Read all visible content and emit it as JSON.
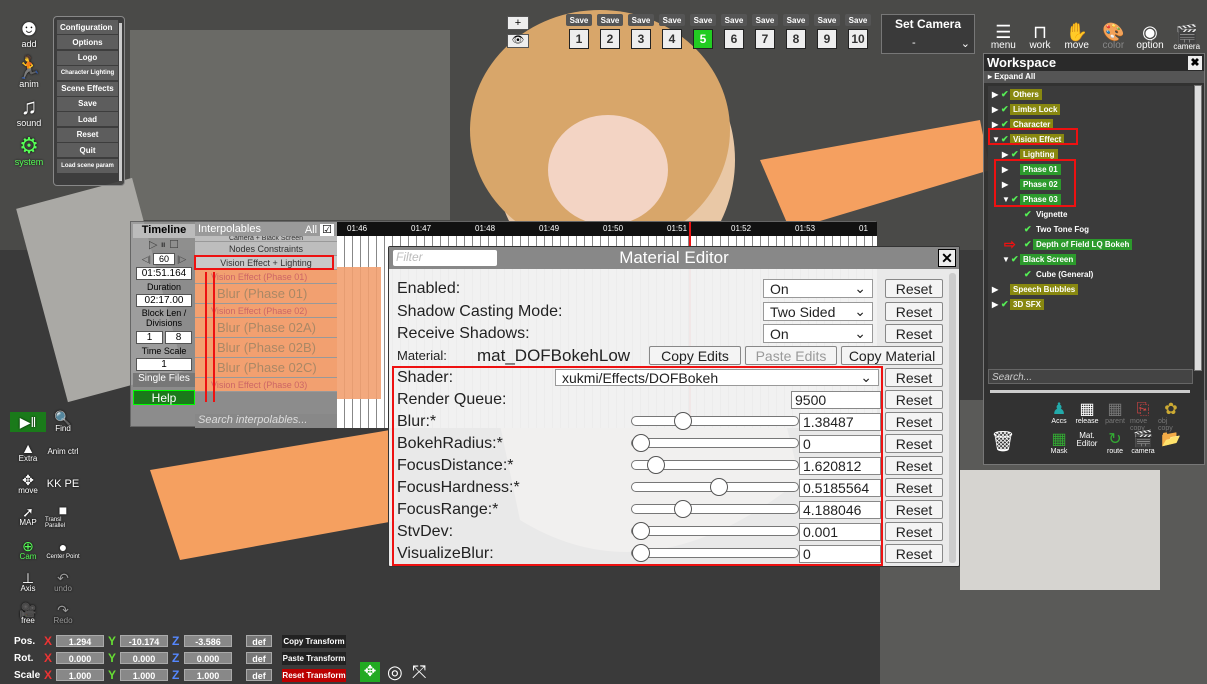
{
  "left_icons": [
    {
      "label": "add",
      "icon": "add-icon"
    },
    {
      "label": "anim",
      "icon": "anim-icon"
    },
    {
      "label": "sound",
      "icon": "sound-icon"
    },
    {
      "label": "system",
      "icon": "system-icon"
    }
  ],
  "config_menu": [
    "Configuration",
    "Options",
    "Logo",
    "Character Lighting",
    "Scene Effects",
    "Save",
    "Load",
    "Reset",
    "Quit",
    "Load scene param"
  ],
  "save_slots": {
    "save_label": "Save",
    "numbers": [
      "1",
      "2",
      "3",
      "4",
      "5",
      "6",
      "7",
      "8",
      "9",
      "10"
    ],
    "active": "5"
  },
  "set_camera": {
    "title": "Set Camera",
    "value": "-"
  },
  "top_icons": [
    "menu",
    "work",
    "move",
    "color",
    "option",
    "camera"
  ],
  "workspace": {
    "title": "Workspace",
    "expand_all": "Expand All",
    "tree": [
      {
        "label": "Others",
        "level": 0
      },
      {
        "label": "Limbs Lock",
        "level": 0
      },
      {
        "label": "Character",
        "level": 0
      },
      {
        "label": "Vision Effect",
        "level": 0
      },
      {
        "label": "Lighting",
        "level": 1
      },
      {
        "label": "Phase 01",
        "level": 1
      },
      {
        "label": "Phase 02",
        "level": 1
      },
      {
        "label": "Phase 03",
        "level": 1
      },
      {
        "label": "Vignette",
        "level": 2
      },
      {
        "label": "Two Tone Fog",
        "level": 2
      },
      {
        "label": "Depth of Field LQ Bokeh",
        "level": 2
      },
      {
        "label": "Black Screen",
        "level": 1
      },
      {
        "label": "Cube (General)",
        "level": 2
      },
      {
        "label": "Speech Bubbles",
        "level": 0
      },
      {
        "label": "3D SFX",
        "level": 0
      }
    ],
    "search_placeholder": "Search...",
    "tools": [
      "Accs",
      "release",
      "parent",
      "move copy",
      "obj copy",
      "Mask",
      "Mat. Editor",
      "route",
      "camera"
    ]
  },
  "timeline": {
    "title": "Timeline",
    "fps": "60",
    "time": "01:51.164",
    "duration_label": "Duration",
    "duration": "02:17.00",
    "block_label": "Block Len / Divisions",
    "block_len": "1",
    "divisions": "8",
    "time_scale_label": "Time Scale",
    "time_scale": "1",
    "single_files": "Single Files",
    "help": "Help",
    "interpolables_label": "Interpolables",
    "all_label": "All",
    "rows": [
      "Camera + Black Screen",
      "Nodes Constraints",
      "Vision Effect + Lighting",
      "Vision Effect (Phase 01)",
      "Blur (Phase 01)",
      "Vision Effect (Phase 02)",
      "Blur (Phase 02A)",
      "Blur (Phase 02B)",
      "Blur (Phase 02C)",
      "Vision Effect (Phase 03)"
    ],
    "search_placeholder": "Search interpolables...",
    "ruler": [
      "01:46",
      "01:47",
      "01:48",
      "01:49",
      "01:50",
      "01:51",
      "01:52",
      "01:53",
      "01"
    ]
  },
  "material_editor": {
    "title": "Material Editor",
    "filter_placeholder": "Filter",
    "enabled_label": "Enabled:",
    "enabled_value": "On",
    "shadow_label": "Shadow Casting Mode:",
    "shadow_value": "Two Sided",
    "receive_label": "Receive Shadows:",
    "receive_value": "On",
    "material_label": "Material:",
    "material_name": "mat_DOFBokehLow",
    "copy_edits": "Copy Edits",
    "paste_edits": "Paste Edits",
    "copy_material": "Copy Material",
    "shader_label": "Shader:",
    "shader_value": "xukmi/Effects/DOFBokeh",
    "render_queue_label": "Render Queue:",
    "render_queue": "9500",
    "reset": "Reset",
    "props": [
      {
        "label": "Blur:*",
        "value": "1.38487",
        "pos": 0.28
      },
      {
        "label": "BokehRadius:*",
        "value": "0",
        "pos": 0.0
      },
      {
        "label": "FocusDistance:*",
        "value": "1.620812",
        "pos": 0.1
      },
      {
        "label": "FocusHardness:*",
        "value": "0.5185564",
        "pos": 0.52
      },
      {
        "label": "FocusRange:*",
        "value": "4.188046",
        "pos": 0.28
      },
      {
        "label": "StvDev:",
        "value": "0.001",
        "pos": 0.0
      },
      {
        "label": "VisualizeBlur:",
        "value": "0",
        "pos": 0.0
      }
    ]
  },
  "side_tools": [
    "Find",
    "Anim ctrl",
    "Extra",
    "KK PE",
    "move",
    "MAP",
    "Transl Parallel",
    "Cam",
    "Center Point",
    "Axis",
    "undo",
    "free",
    "Redo"
  ],
  "transform": {
    "pos_label": "Pos.",
    "rot_label": "Rot.",
    "scale_label": "Scale",
    "pos": [
      "1.294",
      "-10.174",
      "-3.586"
    ],
    "rot": [
      "0.000",
      "0.000",
      "0.000"
    ],
    "scale": [
      "1.000",
      "1.000",
      "1.000"
    ],
    "def": "def",
    "copy": "Copy Transform",
    "paste": "Paste Transform",
    "reset": "Reset Transform"
  },
  "colors": {
    "accent_red": "#e11111",
    "green": "#1a7a1a",
    "orange_track": "#f2a070"
  }
}
